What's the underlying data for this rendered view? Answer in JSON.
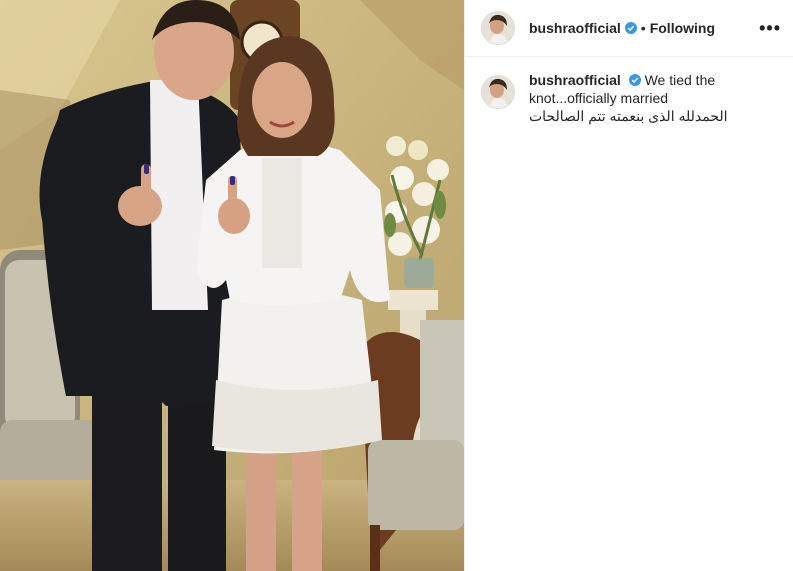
{
  "post": {
    "username": "bushraofficial",
    "follow_status": "Following",
    "separator": "•",
    "more_label": "•••",
    "caption_text": "We tied the knot...officially married",
    "caption_arabic": "الحمدلله الذى بنعمته تتم الصالحات"
  },
  "colors": {
    "verified_badge": "#3897f0",
    "text": "#262626",
    "divider": "#efefef"
  },
  "icons": {
    "verified": "verified-badge-icon",
    "more": "more-options-icon"
  }
}
